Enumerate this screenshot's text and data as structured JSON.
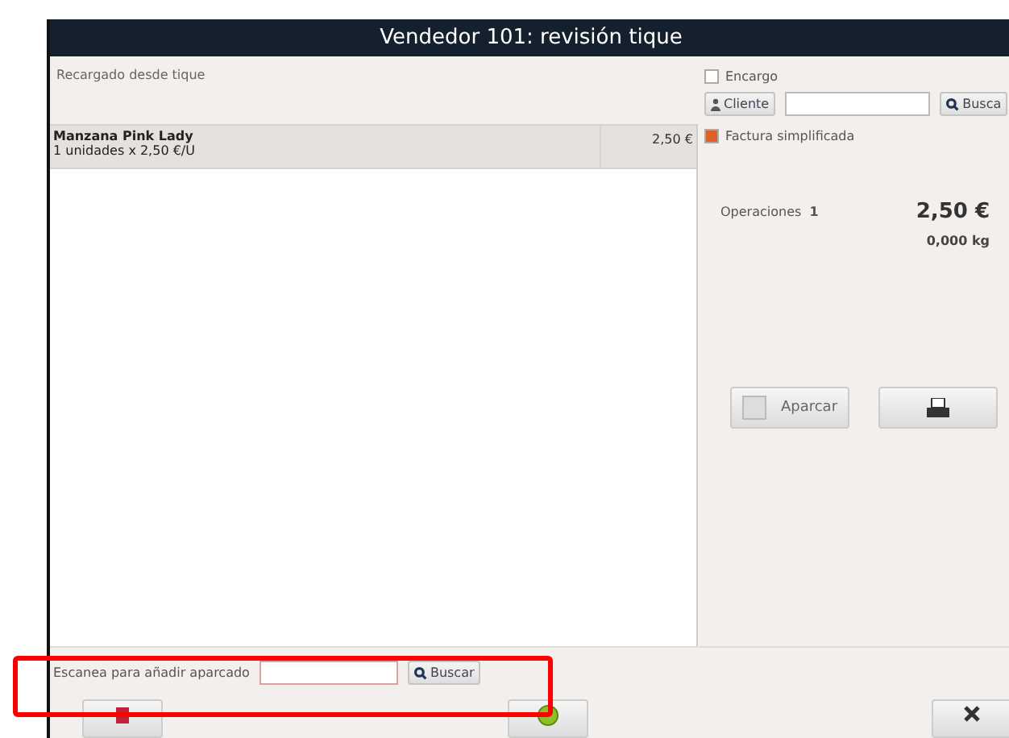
{
  "window": {
    "title": "Vendedor 101: revisión tique"
  },
  "ticket": {
    "note": "Recargado desde tique",
    "items": [
      {
        "name": "Manzana Pink Lady",
        "detail": "1 unidades x 2,50 €/U",
        "price": "2,50 €",
        "selected": true
      }
    ]
  },
  "customer": {
    "order": {
      "label": "Encargo",
      "checked": false
    },
    "client_button": "Cliente",
    "search_button": "Busca",
    "simplified_invoice": {
      "label": "Factura simplificada",
      "checked": true
    }
  },
  "totals": {
    "operations_label": "Operaciones",
    "operations_count": "1",
    "amount": "2,50 €",
    "weight": "0,000 kg"
  },
  "actions": {
    "park_button": "Aparcar"
  },
  "scan": {
    "label": "Escanea para añadir aparcado",
    "search_button": "Buscar"
  }
}
